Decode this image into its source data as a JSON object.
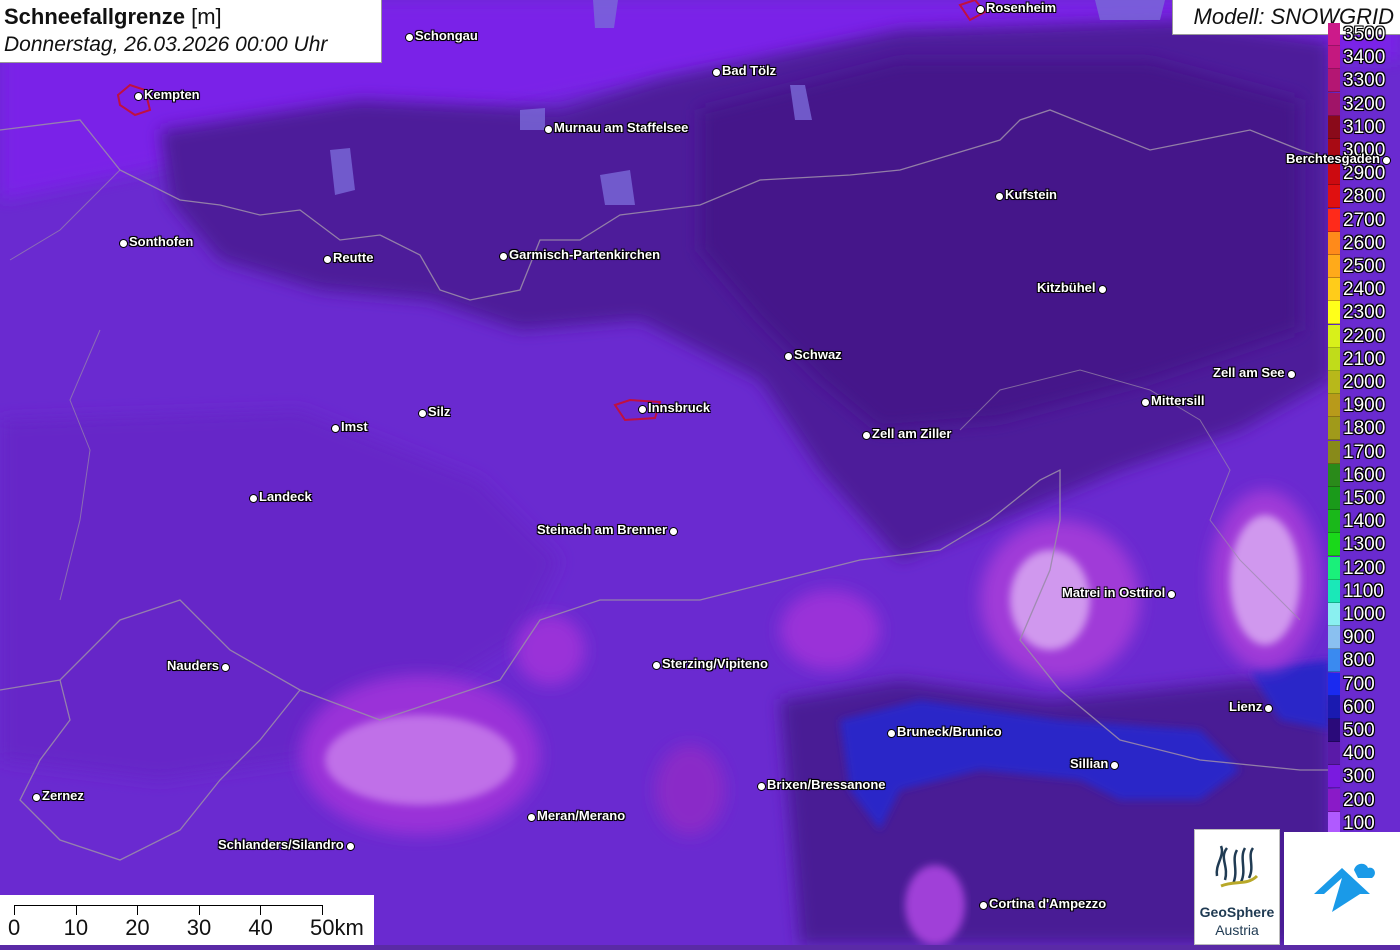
{
  "title": {
    "main": "Schneefallgrenze",
    "unit": "[m]",
    "datetime": "Donnerstag, 26.03.2026 00:00 Uhr"
  },
  "model": "Modell: SNOWGRID",
  "legend": [
    {
      "label": "3500",
      "color": "#cc1a8a"
    },
    {
      "label": "3400",
      "color": "#c4187f"
    },
    {
      "label": "3300",
      "color": "#b41673"
    },
    {
      "label": "3200",
      "color": "#a01468"
    },
    {
      "label": "3100",
      "color": "#8a0a1a"
    },
    {
      "label": "3000",
      "color": "#a80a14"
    },
    {
      "label": "2900",
      "color": "#cc0a10"
    },
    {
      "label": "2800",
      "color": "#e01010"
    },
    {
      "label": "2700",
      "color": "#ff2a1a"
    },
    {
      "label": "2600",
      "color": "#ff8a1a"
    },
    {
      "label": "2500",
      "color": "#ffaa1a"
    },
    {
      "label": "2400",
      "color": "#ffcc1a"
    },
    {
      "label": "2300",
      "color": "#ffff1a"
    },
    {
      "label": "2200",
      "color": "#d8f01a"
    },
    {
      "label": "2100",
      "color": "#c0dc1a"
    },
    {
      "label": "2000",
      "color": "#b8b81a"
    },
    {
      "label": "1900",
      "color": "#b89a1a"
    },
    {
      "label": "1800",
      "color": "#a09a1a"
    },
    {
      "label": "1700",
      "color": "#888a1a"
    },
    {
      "label": "1600",
      "color": "#2a8a1a"
    },
    {
      "label": "1500",
      "color": "#1a9a1a"
    },
    {
      "label": "1400",
      "color": "#1ab81a"
    },
    {
      "label": "1300",
      "color": "#1ad81a"
    },
    {
      "label": "1200",
      "color": "#1af07a"
    },
    {
      "label": "1100",
      "color": "#1ae8b8"
    },
    {
      "label": "1000",
      "color": "#8af0f0"
    },
    {
      "label": "900",
      "color": "#8ac0f0"
    },
    {
      "label": "800",
      "color": "#3a8af0"
    },
    {
      "label": "700",
      "color": "#1a2af0"
    },
    {
      "label": "600",
      "color": "#1a1ab0"
    },
    {
      "label": "500",
      "color": "#2a0a7a"
    },
    {
      "label": "400",
      "color": "#5a1aa8"
    },
    {
      "label": "300",
      "color": "#7a1ae0"
    },
    {
      "label": "200",
      "color": "#8a1ac8"
    },
    {
      "label": "100",
      "color": "#b05aff"
    }
  ],
  "cities": [
    {
      "name": "Schongau",
      "side": "right"
    },
    {
      "name": "Rosenheim",
      "side": "right"
    },
    {
      "name": "Bad Tölz",
      "side": "right"
    },
    {
      "name": "Kempten",
      "side": "right"
    },
    {
      "name": "Murnau am Staffelsee",
      "side": "right"
    },
    {
      "name": "Berchtesgaden",
      "side": "left"
    },
    {
      "name": "Kufstein",
      "side": "right"
    },
    {
      "name": "Sonthofen",
      "side": "right"
    },
    {
      "name": "Reutte",
      "side": "right"
    },
    {
      "name": "Garmisch-Partenkirchen",
      "side": "right"
    },
    {
      "name": "Kitzbühel",
      "side": "left"
    },
    {
      "name": "Schwaz",
      "side": "right"
    },
    {
      "name": "Zell am See",
      "side": "left"
    },
    {
      "name": "Mittersill",
      "side": "right"
    },
    {
      "name": "Innsbruck",
      "side": "right"
    },
    {
      "name": "Silz",
      "side": "right"
    },
    {
      "name": "Imst",
      "side": "right"
    },
    {
      "name": "Zell am Ziller",
      "side": "right"
    },
    {
      "name": "Landeck",
      "side": "right"
    },
    {
      "name": "Steinach am Brenner",
      "side": "left"
    },
    {
      "name": "Matrei in Osttirol",
      "side": "left"
    },
    {
      "name": "Nauders",
      "side": "left"
    },
    {
      "name": "Sterzing/Vipiteno",
      "side": "right"
    },
    {
      "name": "Lienz",
      "side": "left"
    },
    {
      "name": "Bruneck/Brunico",
      "side": "right"
    },
    {
      "name": "Sillian",
      "side": "left"
    },
    {
      "name": "Brixen/Bressanone",
      "side": "right"
    },
    {
      "name": "Zernez",
      "side": "right"
    },
    {
      "name": "Meran/Merano",
      "side": "right"
    },
    {
      "name": "Schlanders/Silandro",
      "side": "left"
    },
    {
      "name": "Cortina d'Ampezzo",
      "side": "right"
    }
  ],
  "scale": {
    "labels": [
      "0",
      "10",
      "20",
      "30",
      "40",
      "50km"
    ]
  },
  "logos": {
    "geosphere_line1": "GeoSphere",
    "geosphere_line2": "Austria"
  }
}
